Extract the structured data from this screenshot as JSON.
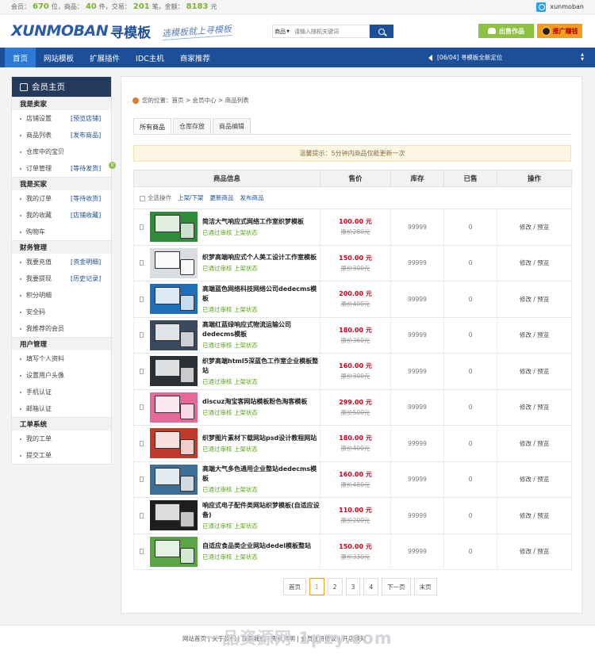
{
  "topbar": {
    "l1": "会员：",
    "n1": "670",
    "l2": "位，商品：",
    "n2": "40",
    "l3": "件，交易：",
    "n3": "201",
    "l4": "笔，金额：",
    "n4": "8183",
    "l5": "元",
    "username": "xunmoban"
  },
  "header": {
    "logo_en": "XUNMOBAN",
    "logo_cn": "寻模板",
    "slogan": "选模板就上寻模板",
    "search_cat": "商品",
    "search_placeholder": "请输入随机关键词",
    "sell_label": "出售作品",
    "promo_label": "推广赚钱"
  },
  "nav": {
    "items": [
      "首页",
      "网站模板",
      "扩展插件",
      "IDC主机",
      "商家推荐"
    ],
    "notice": "[06/04] 寻模板全新定位"
  },
  "sidebar": {
    "title": "会员主页",
    "groups": [
      {
        "title": "我是卖家",
        "items": [
          {
            "label": "店铺设置",
            "extra": "[预览店铺]"
          },
          {
            "label": "商品列表",
            "extra": "[发布商品]"
          },
          {
            "label": "仓库中的宝贝",
            "extra": ""
          },
          {
            "label": "订单管理",
            "extra": "[等待发货]",
            "badge": "0"
          }
        ]
      },
      {
        "title": "我是买家",
        "items": [
          {
            "label": "我的订单",
            "extra": "[等待收货]"
          },
          {
            "label": "我的收藏",
            "extra": "[店铺收藏]"
          },
          {
            "label": "购物车",
            "extra": ""
          }
        ]
      },
      {
        "title": "财务管理",
        "items": [
          {
            "label": "我要充值",
            "extra": "[资金明细]"
          },
          {
            "label": "我要提现",
            "extra": "[历史记录]"
          },
          {
            "label": "积分明细",
            "extra": ""
          },
          {
            "label": "安全码",
            "extra": ""
          },
          {
            "label": "我推荐的会员",
            "extra": ""
          }
        ]
      },
      {
        "title": "用户管理",
        "items": [
          {
            "label": "填写个人资料",
            "extra": ""
          },
          {
            "label": "设置用户头像",
            "extra": ""
          },
          {
            "label": "手机认证",
            "extra": ""
          },
          {
            "label": "邮箱认证",
            "extra": ""
          }
        ]
      },
      {
        "title": "工单系统",
        "items": [
          {
            "label": "我的工单",
            "extra": ""
          },
          {
            "label": "提交工单",
            "extra": ""
          }
        ]
      }
    ]
  },
  "main": {
    "breadcrumb": "您的位置：首页 > 会员中心 > 商品列表",
    "tabs": [
      "所有商品",
      "仓库存放",
      "商品编辑"
    ],
    "tip": "温馨提示：5分钟内商品仅能更新一次",
    "headers": [
      "商品信息",
      "售价",
      "库存",
      "已售",
      "操作"
    ],
    "actions": [
      "全选操作",
      "上架/下架",
      "更新商品",
      "发布商品"
    ],
    "products": [
      {
        "name": "简洁大气响应式网络工作室织梦模板",
        "status": "已通过审核 上架状态",
        "price": "100.00 元",
        "old": "原价280元",
        "stock": "99999",
        "sold": "0",
        "op": "修改 / 预览",
        "color": "#2f8a3a"
      },
      {
        "name": "织梦高端响应式个人美工设计工作室模板",
        "status": "已通过审核 上架状态",
        "price": "150.00 元",
        "old": "原价300元",
        "stock": "99999",
        "sold": "0",
        "op": "修改 / 预览",
        "color": "#d9dde2"
      },
      {
        "name": "高端蓝色网络科技网络公司dedecms模板",
        "status": "已通过审核 上架状态",
        "price": "200.00 元",
        "old": "原价400元",
        "stock": "99999",
        "sold": "0",
        "op": "修改 / 预览",
        "color": "#1f6fb8"
      },
      {
        "name": "高端红蓝绿响应式物流运输公司dedecms模板",
        "status": "已通过审核 上架状态",
        "price": "180.00 元",
        "old": "原价360元",
        "stock": "99999",
        "sold": "0",
        "op": "修改 / 预览",
        "color": "#3a4a5e"
      },
      {
        "name": "织梦高端html5深蓝色工作室企业模板整站",
        "status": "已通过审核 上架状态",
        "price": "160.00 元",
        "old": "原价300元",
        "stock": "99999",
        "sold": "0",
        "op": "修改 / 预览",
        "color": "#2b2f36"
      },
      {
        "name": "discuz淘宝客网站模板粉色淘客模板",
        "status": "已通过审核 上架状态",
        "price": "299.00 元",
        "old": "原价500元",
        "stock": "99999",
        "sold": "0",
        "op": "修改 / 预览",
        "color": "#e46a9a"
      },
      {
        "name": "织梦图片素材下载网站psd设计教程网站",
        "status": "已通过审核 上架状态",
        "price": "180.00 元",
        "old": "原价400元",
        "stock": "99999",
        "sold": "0",
        "op": "修改 / 预览",
        "color": "#c0392b"
      },
      {
        "name": "高端大气多色通用企业整站dedecms模板",
        "status": "已通过审核 上架状态",
        "price": "160.00 元",
        "old": "原价480元",
        "stock": "99999",
        "sold": "0",
        "op": "修改 / 预览",
        "color": "#3d6f96"
      },
      {
        "name": "响应式电子配件类网站织梦模板(自适应设备)",
        "status": "已通过审核 上架状态",
        "price": "110.00 元",
        "old": "原价200元",
        "stock": "99999",
        "sold": "0",
        "op": "修改 / 预览",
        "color": "#1e1e1e"
      },
      {
        "name": "自适应食品类企业网站dedel模板整站",
        "status": "已通过审核 上架状态",
        "price": "150.00 元",
        "old": "原价330元",
        "stock": "99999",
        "sold": "0",
        "op": "修改 / 预览",
        "color": "#5aa646"
      }
    ],
    "pager": [
      "首页",
      "1",
      "2",
      "3",
      "4",
      "下一页",
      "末页"
    ]
  },
  "footer": {
    "links": "网站首页 | 关于我们 | 联系我们 | 免责声明 | 会员注册协议 | 开店须知",
    "watermark": "一品资源网 1pzy.com"
  }
}
